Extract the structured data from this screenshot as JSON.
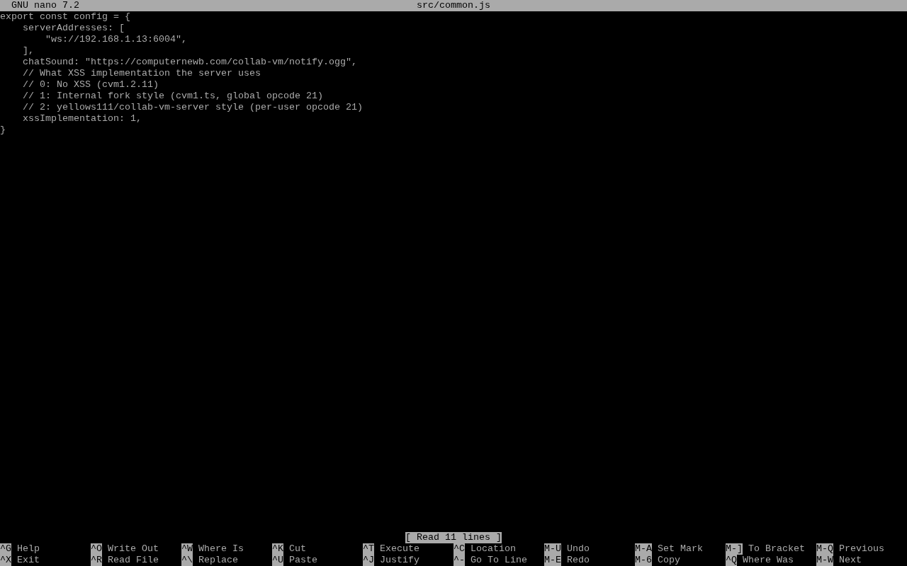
{
  "title_bar": {
    "app": "GNU nano 7.2",
    "file": "src/common.js"
  },
  "lines": [
    "export const config = {",
    "    serverAddresses: [",
    "        \"ws://192.168.1.13:6004\",",
    "    ],",
    "    chatSound: \"https://computernewb.com/collab-vm/notify.ogg\",",
    "    // What XSS implementation the server uses",
    "    // 0: No XSS (cvm1.2.11)",
    "    // 1: Internal fork style (cvm1.ts, global opcode 21)",
    "    // 2: yellows111/collab-vm-server style (per-user opcode 21)",
    "    xssImplementation: 1,",
    "}"
  ],
  "status": "[ Read 11 lines ]",
  "shortcuts": [
    [
      {
        "key": "^G",
        "label": "Help"
      },
      {
        "key": "^O",
        "label": "Write Out"
      },
      {
        "key": "^W",
        "label": "Where Is"
      },
      {
        "key": "^K",
        "label": "Cut"
      },
      {
        "key": "^T",
        "label": "Execute"
      },
      {
        "key": "^C",
        "label": "Location"
      },
      {
        "key": "M-U",
        "label": "Undo"
      },
      {
        "key": "M-A",
        "label": "Set Mark"
      },
      {
        "key": "M-]",
        "label": "To Bracket"
      },
      {
        "key": "M-Q",
        "label": "Previous"
      }
    ],
    [
      {
        "key": "^X",
        "label": "Exit"
      },
      {
        "key": "^R",
        "label": "Read File"
      },
      {
        "key": "^\\",
        "label": "Replace"
      },
      {
        "key": "^U",
        "label": "Paste"
      },
      {
        "key": "^J",
        "label": "Justify"
      },
      {
        "key": "^-",
        "label": "Go To Line"
      },
      {
        "key": "M-E",
        "label": "Redo"
      },
      {
        "key": "M-6",
        "label": "Copy"
      },
      {
        "key": "^Q",
        "label": "Where Was"
      },
      {
        "key": "M-W",
        "label": "Next"
      }
    ]
  ]
}
